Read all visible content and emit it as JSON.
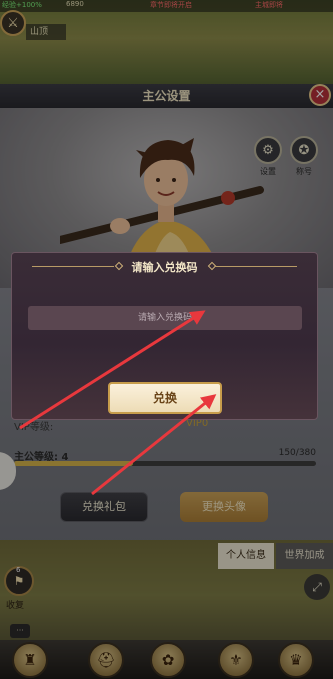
{
  "top_bar": {
    "stat_left": "经验+100%",
    "stat_mid": "6890",
    "stat_red": "章节即将开启",
    "stat_red2": "主城即将"
  },
  "world": {
    "name_chip": "山顶",
    "corner_icon": "crossed-swords-icon",
    "red_badge": "×"
  },
  "panel": {
    "title": "主公设置",
    "close_label": "×",
    "settings_label": "设置",
    "badge_label": "称号",
    "vip_label": "VIP等级:",
    "vip_value": "VIP0",
    "level_label": "主公等级: 4",
    "level_value": "150/380",
    "level_progress": 0.395,
    "redeem_gift_label": "兑换礼包",
    "change_avatar_label": "更换头像"
  },
  "modal": {
    "title": "请输入兑换码",
    "input_placeholder": "请输入兑换码",
    "confirm_label": "兑换"
  },
  "bottom": {
    "tab_info": "个人信息",
    "tab_world": "世界加成",
    "recover_label": "收复",
    "recover_count": "6",
    "chat_label": "···"
  },
  "colors": {
    "arrow": "#e8383d",
    "confirm_border": "#c79d4b"
  }
}
